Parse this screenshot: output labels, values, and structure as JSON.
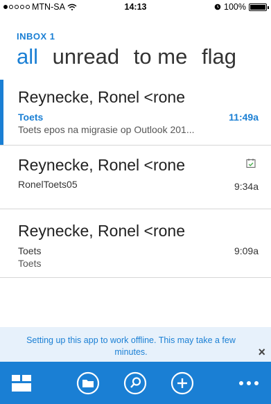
{
  "status_bar": {
    "carrier": "MTN-SA",
    "time": "14:13",
    "battery": "100%",
    "icons": [
      "signal-dots-icon",
      "wifi-icon",
      "alarm-icon",
      "battery-icon"
    ]
  },
  "header": {
    "inbox_label": "INBOX 1",
    "pivots": [
      {
        "label": "all"
      },
      {
        "label": "unread"
      },
      {
        "label": "to me"
      },
      {
        "label": "flag"
      }
    ]
  },
  "messages": [
    {
      "sender": "Reynecke, Ronel <rone",
      "subject": "Toets",
      "preview": "Toets epos na migrasie op Outlook 201...",
      "time": "11:49a",
      "unread": true
    },
    {
      "sender": "Reynecke, Ronel <rone",
      "subject": "RonelToets05",
      "time": "9:34a",
      "icon": "calendar-check-icon"
    },
    {
      "sender": "Reynecke, Ronel <rone",
      "subject": "Toets",
      "preview": "Toets",
      "time": "9:09a"
    }
  ],
  "notice": {
    "text": "Setting up this app to work offline. This may take a few minutes.",
    "close": "×"
  },
  "toolbar": {
    "icons": [
      "tiles-icon",
      "folder-icon",
      "search-icon",
      "add-icon",
      "more-icon"
    ]
  },
  "colors": {
    "accent": "#1a7fd4",
    "notice_bg": "#e7f1fb",
    "divider": "#d6d6d6"
  }
}
